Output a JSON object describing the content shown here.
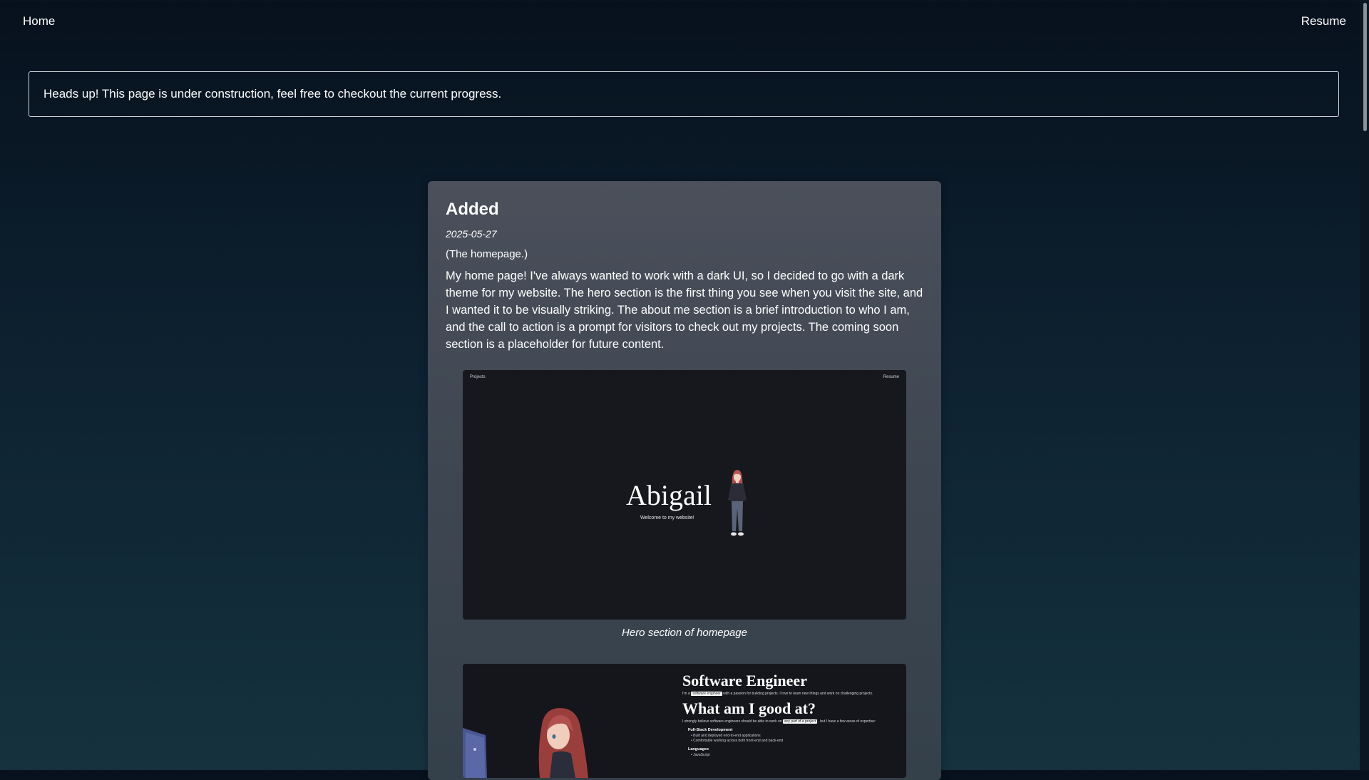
{
  "nav": {
    "home_label": "Home",
    "resume_label": "Resume"
  },
  "banner": {
    "text": "Heads up! This page is under construction, feel free to checkout the current progress."
  },
  "entry": {
    "title": "Added",
    "date": "2025-05-27",
    "subtitle": "(The homepage.)",
    "body": "My home page! I've always wanted to work with a dark UI, so I decided to go with a dark theme for my website. The hero section is the first thing you see when you visit the site, and I wanted it to be visually striking. The about me section is a brief introduction to who I am, and the call to action is a prompt for visitors to check out my projects. The coming soon section is a placeholder for future content."
  },
  "screenshot_hero": {
    "nav_left": "Projects",
    "nav_right": "Resume",
    "name": "Abigail",
    "welcome": "Welcome to my website!",
    "caption": "Hero section of homepage",
    "figure_icon": "anime-girl-figure"
  },
  "screenshot_about": {
    "heading": "Software Engineer",
    "intro_prefix": "I'm a",
    "intro_highlight": "software engineer",
    "intro_suffix": "with a passion for building projects. I love to learn new things and work on challenging projects.",
    "heading2": "What am I good at?",
    "good_prefix": "I strongly believe software engineers should be able to work on",
    "good_highlight": "any part of a project",
    "good_suffix": ", but I have a few areas of expertise:",
    "section1": "Full-Stack Development",
    "items1": [
      "Built and deployed end-to-end applications",
      "Comfortable working across both front-end and back-end"
    ],
    "section2": "Languages",
    "items2": [
      "JavaScript"
    ],
    "illustration_icon": "anime-girl-illustration"
  },
  "colors": {
    "background_top": "#07111d",
    "background_bottom": "#15323e",
    "card": "#454b55",
    "text": "#ffffff"
  }
}
